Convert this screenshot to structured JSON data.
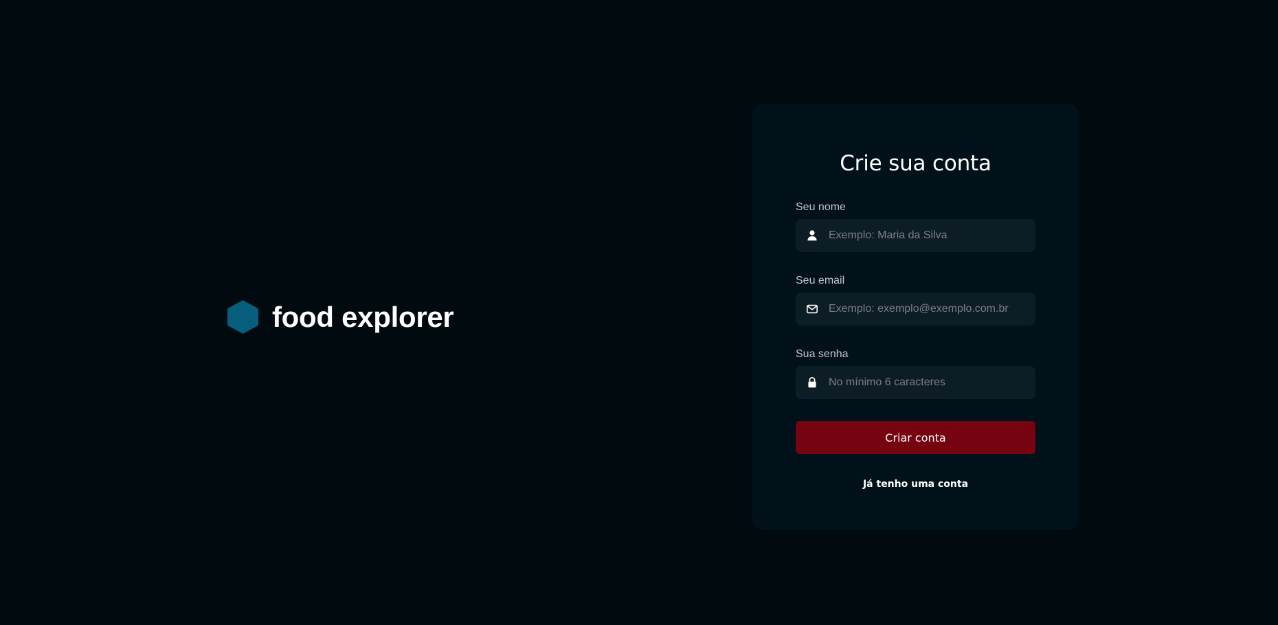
{
  "brand": {
    "name": "food explorer",
    "logo_color": "#065e7c"
  },
  "form": {
    "title": "Crie sua conta",
    "fields": [
      {
        "label": "Seu nome",
        "placeholder": "Exemplo: Maria da Silva",
        "icon": "user-icon",
        "type": "text",
        "value": ""
      },
      {
        "label": "Seu email",
        "placeholder": "Exemplo: exemplo@exemplo.com.br",
        "icon": "mail-icon",
        "type": "email",
        "value": ""
      },
      {
        "label": "Sua senha",
        "placeholder": "No mínimo 6 caracteres",
        "icon": "lock-icon",
        "type": "password",
        "value": ""
      }
    ],
    "submit_label": "Criar conta",
    "submit_color": "#750310",
    "login_link": "Já tenho uma conta"
  },
  "colors": {
    "background": "#000a0f",
    "card": "#001119",
    "input": "#0d1d25"
  }
}
